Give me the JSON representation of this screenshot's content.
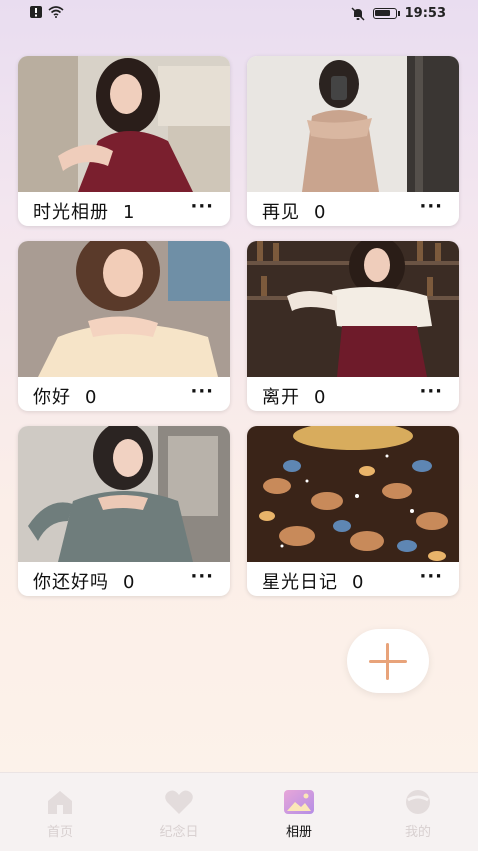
{
  "status": {
    "time": "19:53",
    "battery_level": 0.85
  },
  "albums": [
    {
      "name": "时光相册",
      "count": "1",
      "more": "···"
    },
    {
      "name": "再见",
      "count": "0",
      "more": "···"
    },
    {
      "name": "你好",
      "count": "0",
      "more": "···"
    },
    {
      "name": "离开",
      "count": "0",
      "more": "···"
    },
    {
      "name": "你还好吗",
      "count": "0",
      "more": "···"
    },
    {
      "name": "星光日记",
      "count": "0",
      "more": "···"
    }
  ],
  "tabs": [
    {
      "label": "首页",
      "icon": "home-icon"
    },
    {
      "label": "纪念日",
      "icon": "heart-icon"
    },
    {
      "label": "相册",
      "icon": "album-icon",
      "active": true
    },
    {
      "label": "我的",
      "icon": "profile-icon"
    }
  ],
  "colors": {
    "accent": "#e8a37a",
    "tab_active_icon": "#c98ee0"
  }
}
